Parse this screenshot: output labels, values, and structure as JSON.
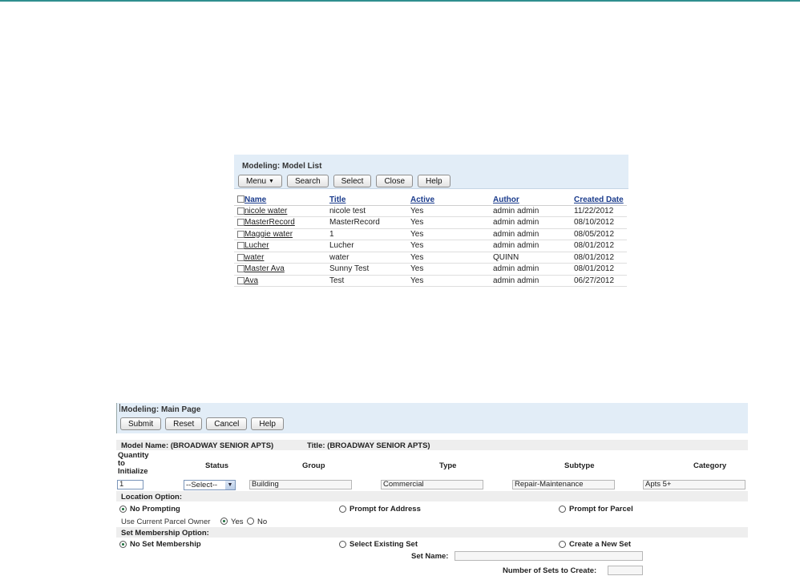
{
  "model_list": {
    "title": "Modeling: Model List",
    "toolbar": {
      "menu": "Menu",
      "search": "Search",
      "select": "Select",
      "close": "Close",
      "help": "Help"
    },
    "columns": [
      "Name",
      "Title",
      "Active",
      "Author",
      "Created Date"
    ],
    "rows": [
      {
        "name": "nicole water",
        "title": "nicole test",
        "active": "Yes",
        "author": "admin admin",
        "created": "11/22/2012"
      },
      {
        "name": "MasterRecord",
        "title": "MasterRecord",
        "active": "Yes",
        "author": "admin admin",
        "created": "08/10/2012"
      },
      {
        "name": "Maggie water",
        "title": "1",
        "active": "Yes",
        "author": "admin admin",
        "created": "08/05/2012"
      },
      {
        "name": "Lucher",
        "title": "Lucher",
        "active": "Yes",
        "author": "admin admin",
        "created": "08/01/2012"
      },
      {
        "name": "water",
        "title": "water",
        "active": "Yes",
        "author": "QUINN",
        "created": "08/01/2012"
      },
      {
        "name": "Master Ava",
        "title": "Sunny Test",
        "active": "Yes",
        "author": "admin admin",
        "created": "08/01/2012"
      },
      {
        "name": "Ava",
        "title": "Test",
        "active": "Yes",
        "author": "admin admin",
        "created": "06/27/2012"
      }
    ]
  },
  "main_page": {
    "title": "Modeling: Main Page",
    "toolbar": {
      "submit": "Submit",
      "reset": "Reset",
      "cancel": "Cancel",
      "help": "Help"
    },
    "model_name": "Model Name: (BROADWAY SENIOR APTS)",
    "model_title": "Title: (BROADWAY SENIOR APTS)",
    "headers": {
      "quantity_line1": "Quantity",
      "quantity_line2": "to",
      "quantity_line3": "Initialize",
      "status": "Status",
      "group": "Group",
      "type": "Type",
      "subtype": "Subtype",
      "category": "Category"
    },
    "values": {
      "quantity": "1",
      "status": "--Select--",
      "group": "Building",
      "type": "Commercial",
      "subtype": "Repair-Maintenance",
      "category": "Apts 5+"
    },
    "location": {
      "label": "Location Option:",
      "no_prompting": "No Prompting",
      "prompt_address": "Prompt for Address",
      "prompt_parcel": "Prompt for Parcel",
      "use_owner": "Use Current Parcel Owner",
      "yes": "Yes",
      "no": "No"
    },
    "membership": {
      "label": "Set Membership Option:",
      "no_set": "No Set Membership",
      "select_existing": "Select Existing Set",
      "create_new": "Create a New Set",
      "set_name": "Set Name:",
      "num_sets": "Number of Sets to Create:"
    }
  }
}
